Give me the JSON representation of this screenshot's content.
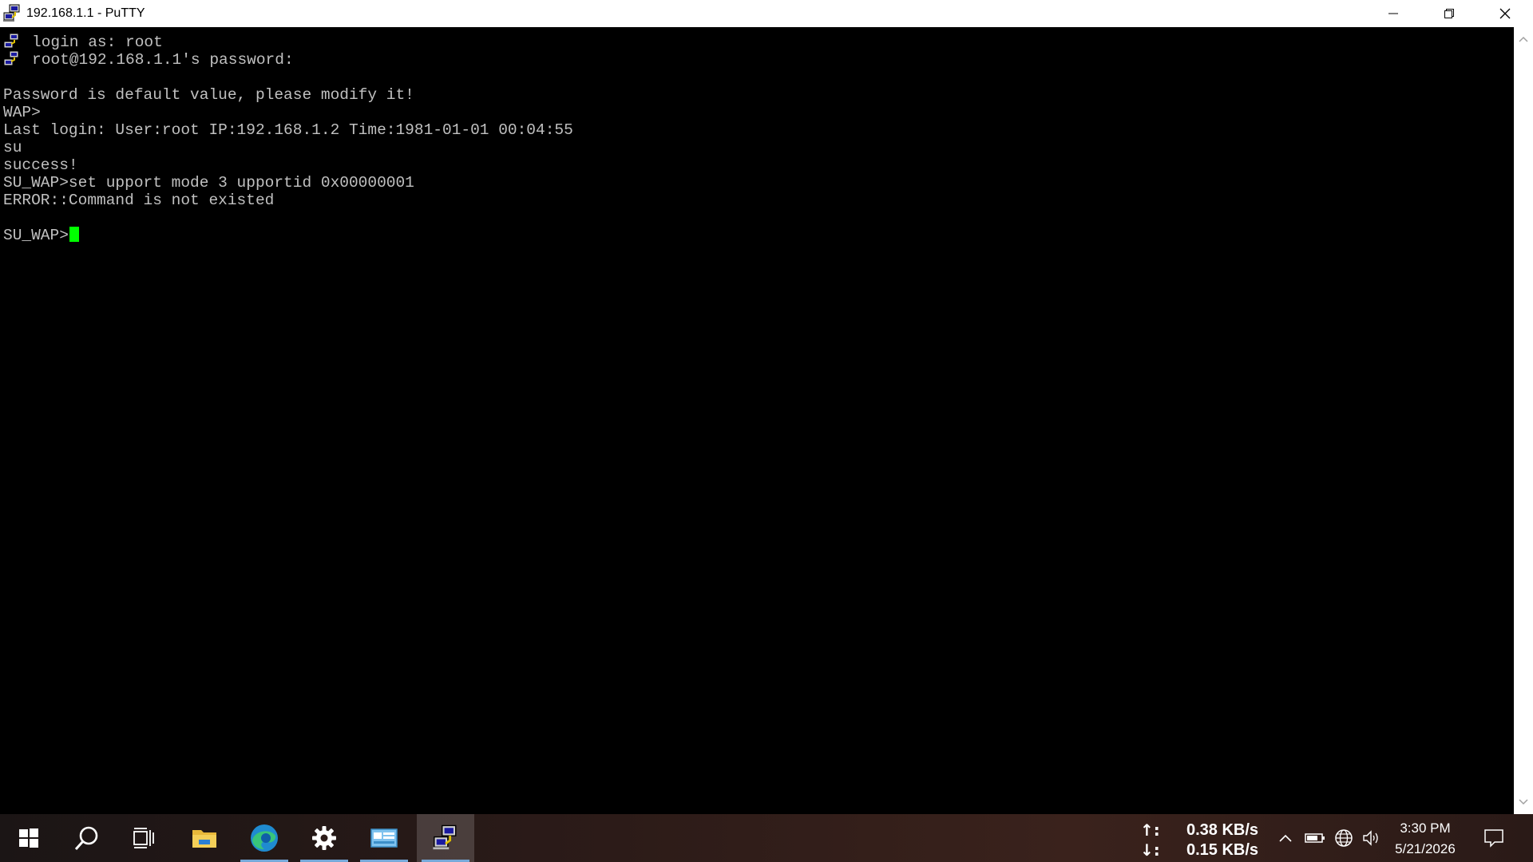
{
  "window": {
    "title": "192.168.1.1 - PuTTY",
    "icons": {
      "app": "putty-icon",
      "minimize": "minimize-icon",
      "restore": "restore-icon",
      "close": "close-icon"
    }
  },
  "terminal": {
    "lines": [
      "login as: root",
      "root@192.168.1.1's password:",
      "",
      "Password is default value, please modify it!",
      "WAP>",
      "Last login: User:root IP:192.168.1.2 Time:1981-01-01 00:04:55",
      "su",
      "success!",
      "SU_WAP>set upport mode 3 upportid 0x00000001",
      "ERROR::Command is not existed",
      "",
      "SU_WAP>"
    ],
    "colors": {
      "background": "#000000",
      "text": "#c0c0c0",
      "cursor": "#00ff00"
    }
  },
  "taskbar": {
    "items": [
      {
        "icon": "windows-start-icon"
      },
      {
        "icon": "search-icon"
      },
      {
        "icon": "task-view-icon"
      },
      {
        "icon": "file-explorer-icon"
      },
      {
        "icon": "edge-browser-icon",
        "running": true
      },
      {
        "icon": "settings-gear-icon",
        "running": true
      },
      {
        "icon": "control-panel-icon",
        "running": true
      },
      {
        "icon": "putty-icon",
        "running": true,
        "active": true
      }
    ],
    "network_speed": {
      "upload_arrow": "↑:",
      "upload": "0.38 KB/s",
      "download_arrow": "↓:",
      "download": "0.15 KB/s"
    },
    "tray_icons": [
      "chevron-up-icon",
      "battery-icon",
      "globe-network-icon",
      "speaker-icon"
    ],
    "clock": {
      "time": "3:30 PM",
      "date": "5/21/2026"
    },
    "notification_icon": "action-center-icon"
  }
}
